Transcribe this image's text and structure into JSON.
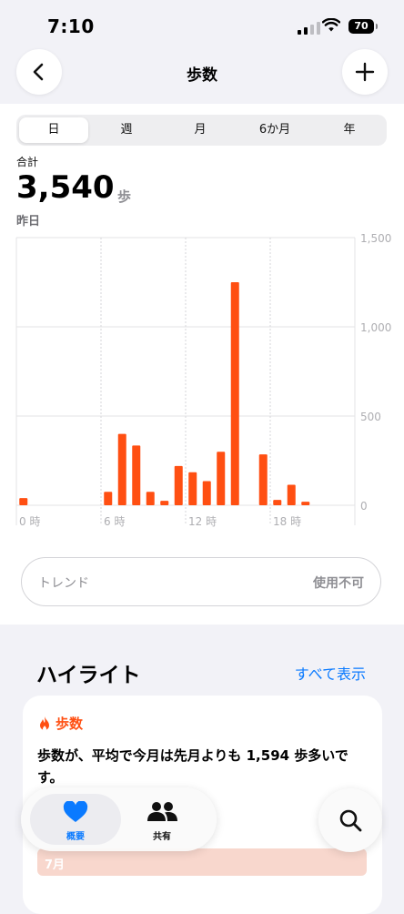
{
  "status": {
    "time": "7:10",
    "battery": "70"
  },
  "nav": {
    "title": "歩数"
  },
  "tabs": [
    "日",
    "週",
    "月",
    "6か月",
    "年"
  ],
  "summary": {
    "label": "合計",
    "value": "3,540",
    "unit": "歩",
    "date": "昨日"
  },
  "chart_data": {
    "type": "bar",
    "x_hours": [
      0,
      6,
      7,
      8,
      9,
      10,
      11,
      12,
      13,
      14,
      15,
      17,
      18,
      19,
      20
    ],
    "values": [
      40,
      75,
      400,
      335,
      75,
      25,
      220,
      185,
      135,
      300,
      1250,
      285,
      30,
      115,
      20
    ],
    "y_ticks": [
      "0",
      "500",
      "1,000",
      "1,500"
    ],
    "ylim": [
      0,
      1500
    ],
    "x_tick_labels": [
      "0 時",
      "6 時",
      "12 時",
      "18 時"
    ],
    "x_tick_hours": [
      0,
      6,
      12,
      18
    ],
    "xlim": [
      0,
      24
    ],
    "color": "#ff4f12"
  },
  "trend": {
    "label": "トレンド",
    "value": "使用不可"
  },
  "highlights": {
    "title": "ハイライト",
    "show_all": "すべて表示",
    "card": {
      "category": "歩数",
      "text": "歩数が、平均で今月は先月よりも 1,594 歩多いです。",
      "month": "7月"
    }
  },
  "tabbar": {
    "summary": "概要",
    "share": "共有"
  },
  "colors": {
    "accent": "#0a7aff",
    "steps": "#ff4f12"
  }
}
